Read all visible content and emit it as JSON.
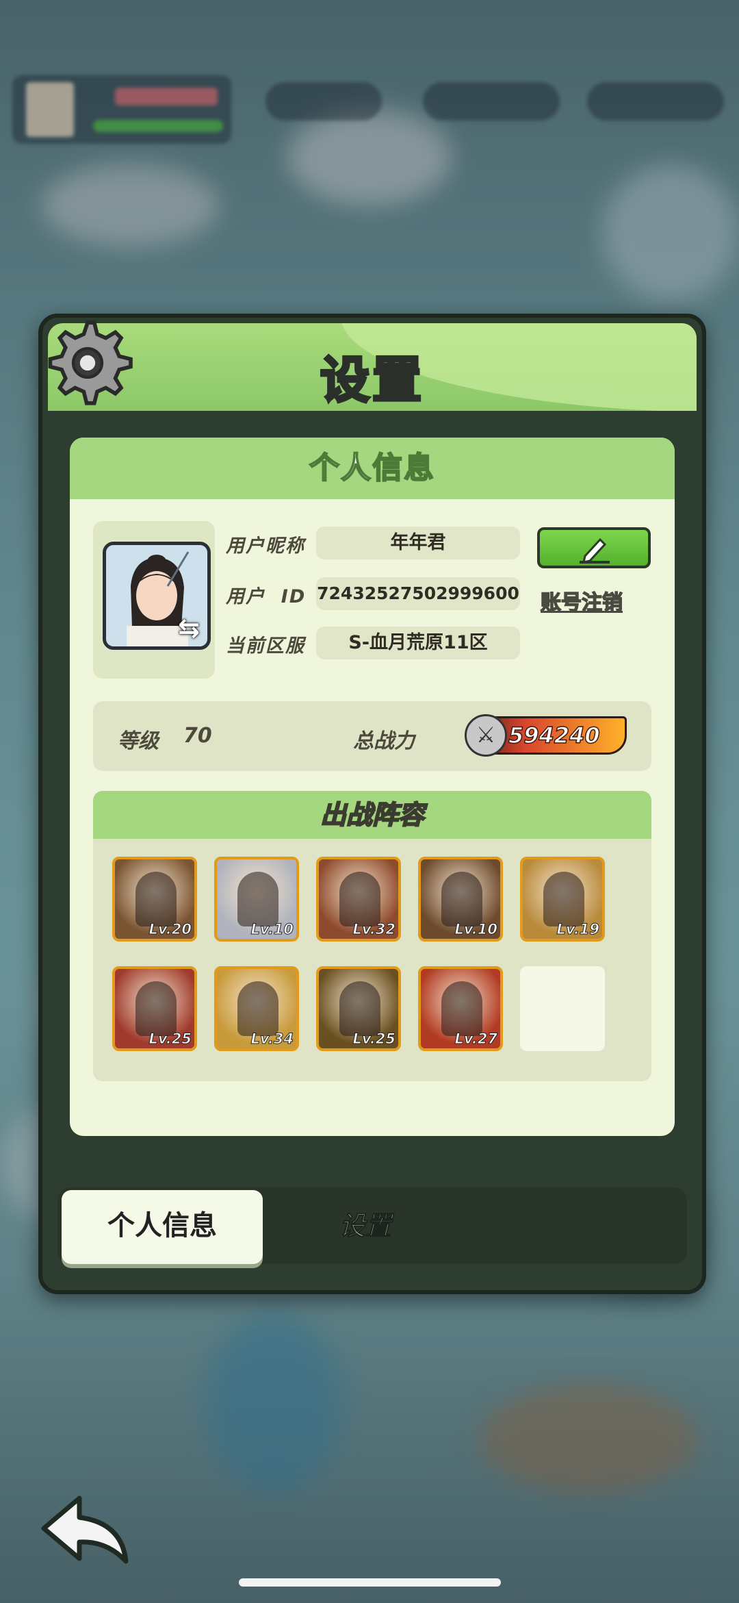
{
  "dialog": {
    "title": "设置",
    "icon": "gear-icon"
  },
  "panel": {
    "title": "个人信息",
    "fields": {
      "nickname_label": "用户昵称",
      "nickname_value": "年年君",
      "id_label": "用户  ID",
      "id_value": "72432527502999600",
      "server_label": "当前区服",
      "server_value": "S-血月荒原11区",
      "logout_label": "账号注销"
    },
    "stats": {
      "level_label": "等级",
      "level_value": "70",
      "power_label": "总战力",
      "power_value": "594240"
    },
    "team": {
      "title": "出战阵容",
      "heroes": [
        {
          "level": "Lv.20",
          "color": "#7a5330"
        },
        {
          "level": "Lv.10",
          "color": "#b0b3bd"
        },
        {
          "level": "Lv.32",
          "color": "#8e4a2c"
        },
        {
          "level": "Lv.10",
          "color": "#6d4a2c"
        },
        {
          "level": "Lv.19",
          "color": "#b98a3a"
        },
        {
          "level": "Lv.25",
          "color": "#a03a2c"
        },
        {
          "level": "Lv.34",
          "color": "#c89a3a"
        },
        {
          "level": "Lv.25",
          "color": "#6a5020"
        },
        {
          "level": "Lv.27",
          "color": "#b23a22"
        }
      ]
    }
  },
  "tabs": {
    "active": "个人信息",
    "idle": "设置"
  },
  "colors": {
    "accent_green": "#a5d780",
    "panel_bg": "#f0f6dc",
    "hero_border": "#e29a1b"
  }
}
